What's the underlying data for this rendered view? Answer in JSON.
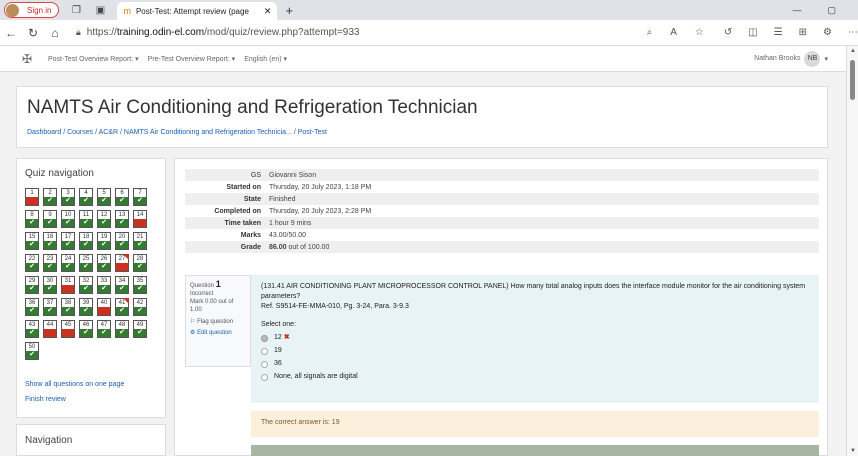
{
  "browser": {
    "signin_label": "Sign in",
    "tab_title": "Post-Test: Attempt review (page",
    "url_prefix": "https://",
    "url_host": "training.odin-el.com",
    "url_path": "/mod/quiz/review.php?attempt=933"
  },
  "topnav": {
    "items": [
      "Post-Test Overview Report: ▾",
      "Pre-Test Overview Report: ▾",
      "English (en) ▾"
    ],
    "user_name": "Nathan Brooks",
    "user_initials": "NB"
  },
  "header": {
    "title": "NAMTS Air Conditioning and Refrigeration Technician",
    "breadcrumb": [
      "Dashboard",
      "Courses",
      "AC&R",
      "NAMTS Air Conditioning and Refrigeration Technicia...",
      "Post-Test"
    ]
  },
  "quiz_nav": {
    "title": "Quiz navigation",
    "questions": [
      {
        "n": "1",
        "s": "i"
      },
      {
        "n": "2",
        "s": "c"
      },
      {
        "n": "3",
        "s": "c"
      },
      {
        "n": "4",
        "s": "c"
      },
      {
        "n": "5",
        "s": "c"
      },
      {
        "n": "6",
        "s": "c"
      },
      {
        "n": "7",
        "s": "c"
      },
      {
        "n": "8",
        "s": "c"
      },
      {
        "n": "9",
        "s": "c"
      },
      {
        "n": "10",
        "s": "c"
      },
      {
        "n": "11",
        "s": "c"
      },
      {
        "n": "12",
        "s": "c"
      },
      {
        "n": "13",
        "s": "c"
      },
      {
        "n": "14",
        "s": "i"
      },
      {
        "n": "15",
        "s": "c"
      },
      {
        "n": "16",
        "s": "c"
      },
      {
        "n": "17",
        "s": "c"
      },
      {
        "n": "18",
        "s": "c"
      },
      {
        "n": "19",
        "s": "c"
      },
      {
        "n": "20",
        "s": "c"
      },
      {
        "n": "21",
        "s": "c"
      },
      {
        "n": "22",
        "s": "c"
      },
      {
        "n": "23",
        "s": "c"
      },
      {
        "n": "24",
        "s": "c"
      },
      {
        "n": "25",
        "s": "c"
      },
      {
        "n": "26",
        "s": "c"
      },
      {
        "n": "27",
        "s": "i",
        "f": true
      },
      {
        "n": "28",
        "s": "c"
      },
      {
        "n": "29",
        "s": "c"
      },
      {
        "n": "30",
        "s": "c"
      },
      {
        "n": "31",
        "s": "i"
      },
      {
        "n": "32",
        "s": "c"
      },
      {
        "n": "33",
        "s": "c"
      },
      {
        "n": "34",
        "s": "c"
      },
      {
        "n": "35",
        "s": "c"
      },
      {
        "n": "36",
        "s": "c"
      },
      {
        "n": "37",
        "s": "c"
      },
      {
        "n": "38",
        "s": "c"
      },
      {
        "n": "39",
        "s": "c"
      },
      {
        "n": "40",
        "s": "i"
      },
      {
        "n": "41",
        "s": "c",
        "f": true
      },
      {
        "n": "42",
        "s": "c"
      },
      {
        "n": "43",
        "s": "c"
      },
      {
        "n": "44",
        "s": "i"
      },
      {
        "n": "45",
        "s": "i"
      },
      {
        "n": "46",
        "s": "c"
      },
      {
        "n": "47",
        "s": "c"
      },
      {
        "n": "48",
        "s": "c"
      },
      {
        "n": "49",
        "s": "c"
      },
      {
        "n": "50",
        "s": "c"
      }
    ],
    "show_all": "Show all questions on one page",
    "finish": "Finish review"
  },
  "navigation_block": {
    "title": "Navigation"
  },
  "summary": {
    "user_initials": "GS",
    "user_name": "Giovanni Sison",
    "rows": [
      {
        "k": "Started on",
        "v": "Thursday, 20 July 2023, 1:18 PM"
      },
      {
        "k": "State",
        "v": "Finished"
      },
      {
        "k": "Completed on",
        "v": "Thursday, 20 July 2023, 2:28 PM"
      },
      {
        "k": "Time taken",
        "v": "1 hour 9 mins"
      },
      {
        "k": "Marks",
        "v": "43.00/50.00"
      }
    ],
    "grade_label": "Grade",
    "grade_value": "86.00",
    "grade_suffix": " out of 100.00"
  },
  "question": {
    "label": "Question",
    "number": "1",
    "status": "Incorrect",
    "mark": "Mark 0.00 out of 1.00",
    "flag": "Flag question",
    "edit": "Edit question",
    "text": "(131.41 AIR CONDITIONING PLANT MICROPROCESSOR CONTROL PANEL) How many total analog inputs does the interface module monitor for the air conditioning system parameters?",
    "ref": "Ref. S9514-FE-MMA-010, Pg. 3-24, Para. 3-9.3",
    "select_one": "Select one:",
    "options": [
      "12",
      "19",
      "36",
      "None, all signals are digital"
    ],
    "correct_answer": "The correct answer is: 19"
  }
}
